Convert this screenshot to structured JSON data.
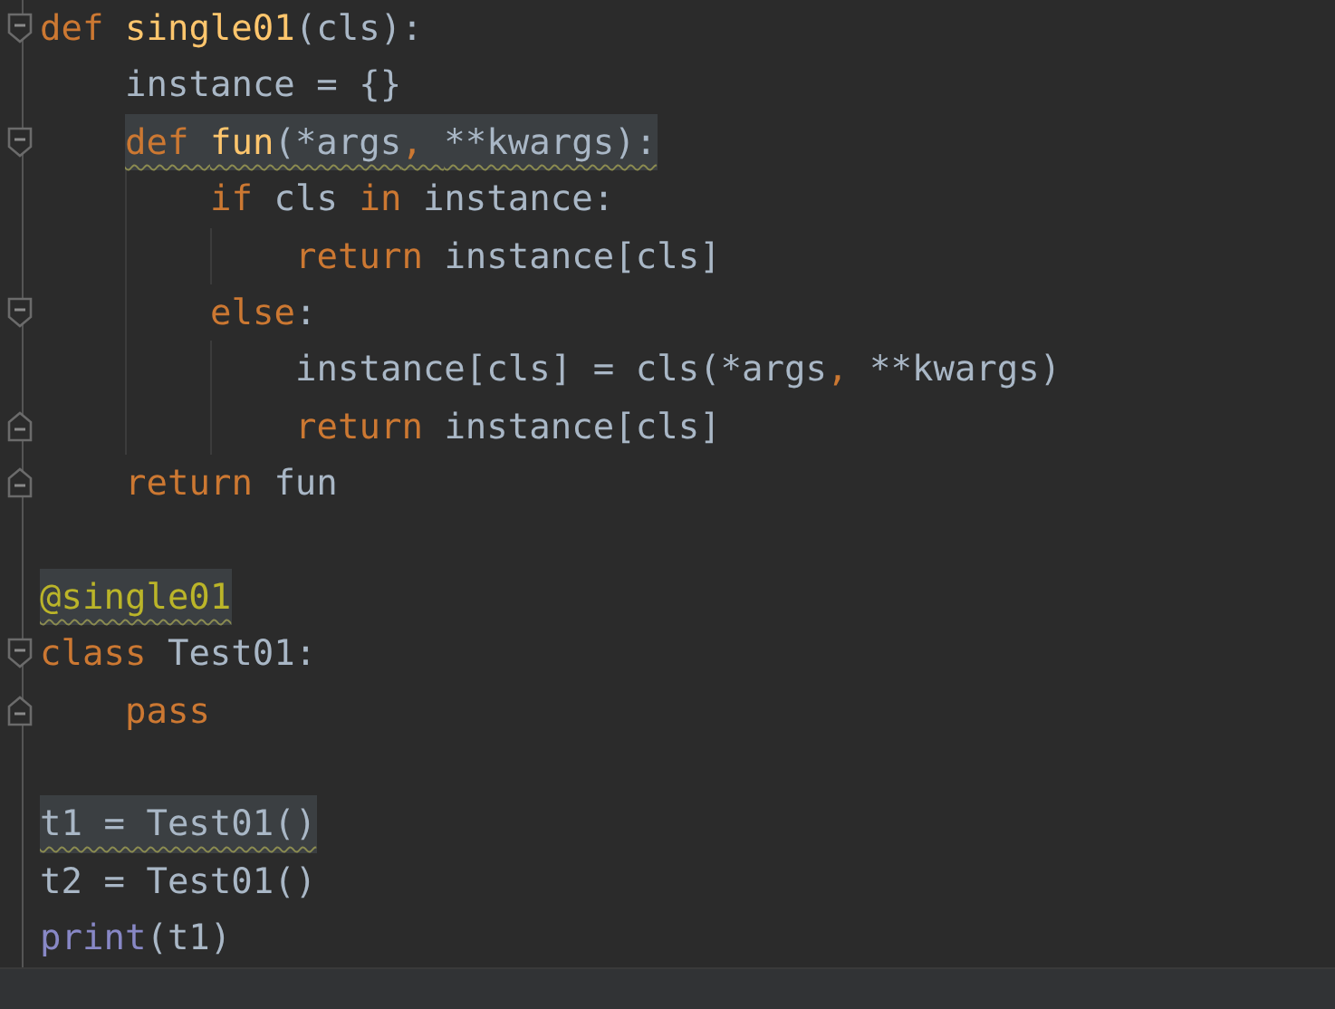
{
  "editor": {
    "blocks": [
      {
        "lines": [
          {
            "fold_start": true,
            "fold_end": false,
            "warning": false,
            "tokens": [
              {
                "kind": "keyword",
                "text": "def "
              },
              {
                "kind": "function",
                "text": "single01"
              },
              {
                "kind": "plain",
                "text": "(cls):"
              }
            ]
          },
          {
            "fold_start": false,
            "fold_end": false,
            "warning": false,
            "tokens": [
              {
                "kind": "plain",
                "text": "    instance = {}"
              }
            ]
          },
          {
            "fold_start": true,
            "fold_end": false,
            "warning": true,
            "tokens": [
              {
                "kind": "keyword",
                "text": "    def "
              },
              {
                "kind": "function",
                "text": "fun"
              },
              {
                "kind": "plain",
                "text": "(*args"
              },
              {
                "kind": "keyword",
                "text": ", "
              },
              {
                "kind": "plain",
                "text": "**kwargs):"
              }
            ]
          },
          {
            "fold_start": false,
            "fold_end": false,
            "warning": false,
            "tokens": [
              {
                "kind": "keyword",
                "text": "        if "
              },
              {
                "kind": "plain",
                "text": "cls "
              },
              {
                "kind": "keyword",
                "text": "in "
              },
              {
                "kind": "plain",
                "text": "instance:"
              }
            ]
          },
          {
            "fold_start": false,
            "fold_end": false,
            "warning": false,
            "tokens": [
              {
                "kind": "keyword",
                "text": "            return "
              },
              {
                "kind": "plain",
                "text": "instance[cls]"
              }
            ]
          },
          {
            "fold_start": true,
            "fold_end": false,
            "warning": false,
            "tokens": [
              {
                "kind": "keyword",
                "text": "        else"
              },
              {
                "kind": "plain",
                "text": ":"
              }
            ]
          },
          {
            "fold_start": false,
            "fold_end": false,
            "warning": false,
            "tokens": [
              {
                "kind": "plain",
                "text": "            instance[cls] = cls(*args"
              },
              {
                "kind": "keyword",
                "text": ", "
              },
              {
                "kind": "plain",
                "text": "**kwargs)"
              }
            ]
          },
          {
            "fold_start": false,
            "fold_end": true,
            "warning": false,
            "tokens": [
              {
                "kind": "keyword",
                "text": "            return "
              },
              {
                "kind": "plain",
                "text": "instance[cls]"
              }
            ]
          },
          {
            "fold_start": false,
            "fold_end": true,
            "warning": false,
            "tokens": [
              {
                "kind": "keyword",
                "text": "    return "
              },
              {
                "kind": "plain",
                "text": "fun"
              }
            ]
          }
        ]
      },
      {
        "lines": [
          {
            "fold_start": false,
            "fold_end": false,
            "warning": true,
            "tokens": [
              {
                "kind": "decorator",
                "text": "@single01"
              }
            ]
          },
          {
            "fold_start": true,
            "fold_end": false,
            "warning": false,
            "tokens": [
              {
                "kind": "keyword",
                "text": "class "
              },
              {
                "kind": "plain",
                "text": "Test01:"
              }
            ]
          },
          {
            "fold_start": false,
            "fold_end": true,
            "warning": false,
            "tokens": [
              {
                "kind": "keyword",
                "text": "    pass"
              }
            ]
          }
        ]
      },
      {
        "lines": [
          {
            "fold_start": false,
            "fold_end": false,
            "warning": true,
            "tokens": [
              {
                "kind": "plain",
                "text": "t1 = Test01()"
              }
            ]
          },
          {
            "fold_start": false,
            "fold_end": false,
            "warning": false,
            "tokens": [
              {
                "kind": "plain",
                "text": "t2 = Test01()"
              }
            ]
          },
          {
            "fold_start": false,
            "fold_end": false,
            "warning": false,
            "tokens": [
              {
                "kind": "builtin",
                "text": "print"
              },
              {
                "kind": "plain",
                "text": "(t1)"
              }
            ]
          }
        ]
      }
    ]
  }
}
